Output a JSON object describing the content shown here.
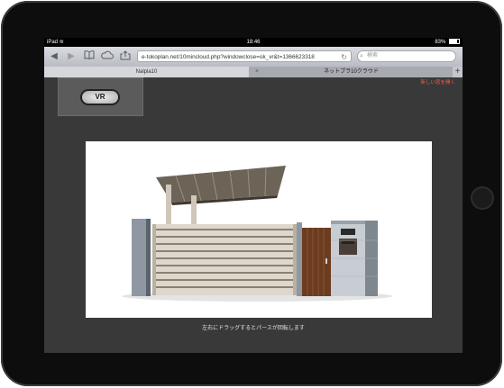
{
  "status": {
    "device": "iPad",
    "time": "18:46",
    "battery": "83%"
  },
  "toolbar": {
    "url": "e-tokoplan.net/10mincloud.php?windowclose=ok_vr&t=1366623318",
    "search_placeholder": "検索"
  },
  "tabs": [
    {
      "label": "Nalpla10",
      "active": true
    },
    {
      "label": "ネットプラ10クラウド",
      "active": false
    }
  ],
  "page": {
    "vr_label": "VR",
    "link_text": "新しい窓を開く",
    "caption": "左右にドラッグするとパースが回転します"
  },
  "colors": {
    "accent": "#ff5a3c",
    "screen_bg": "#393939"
  }
}
